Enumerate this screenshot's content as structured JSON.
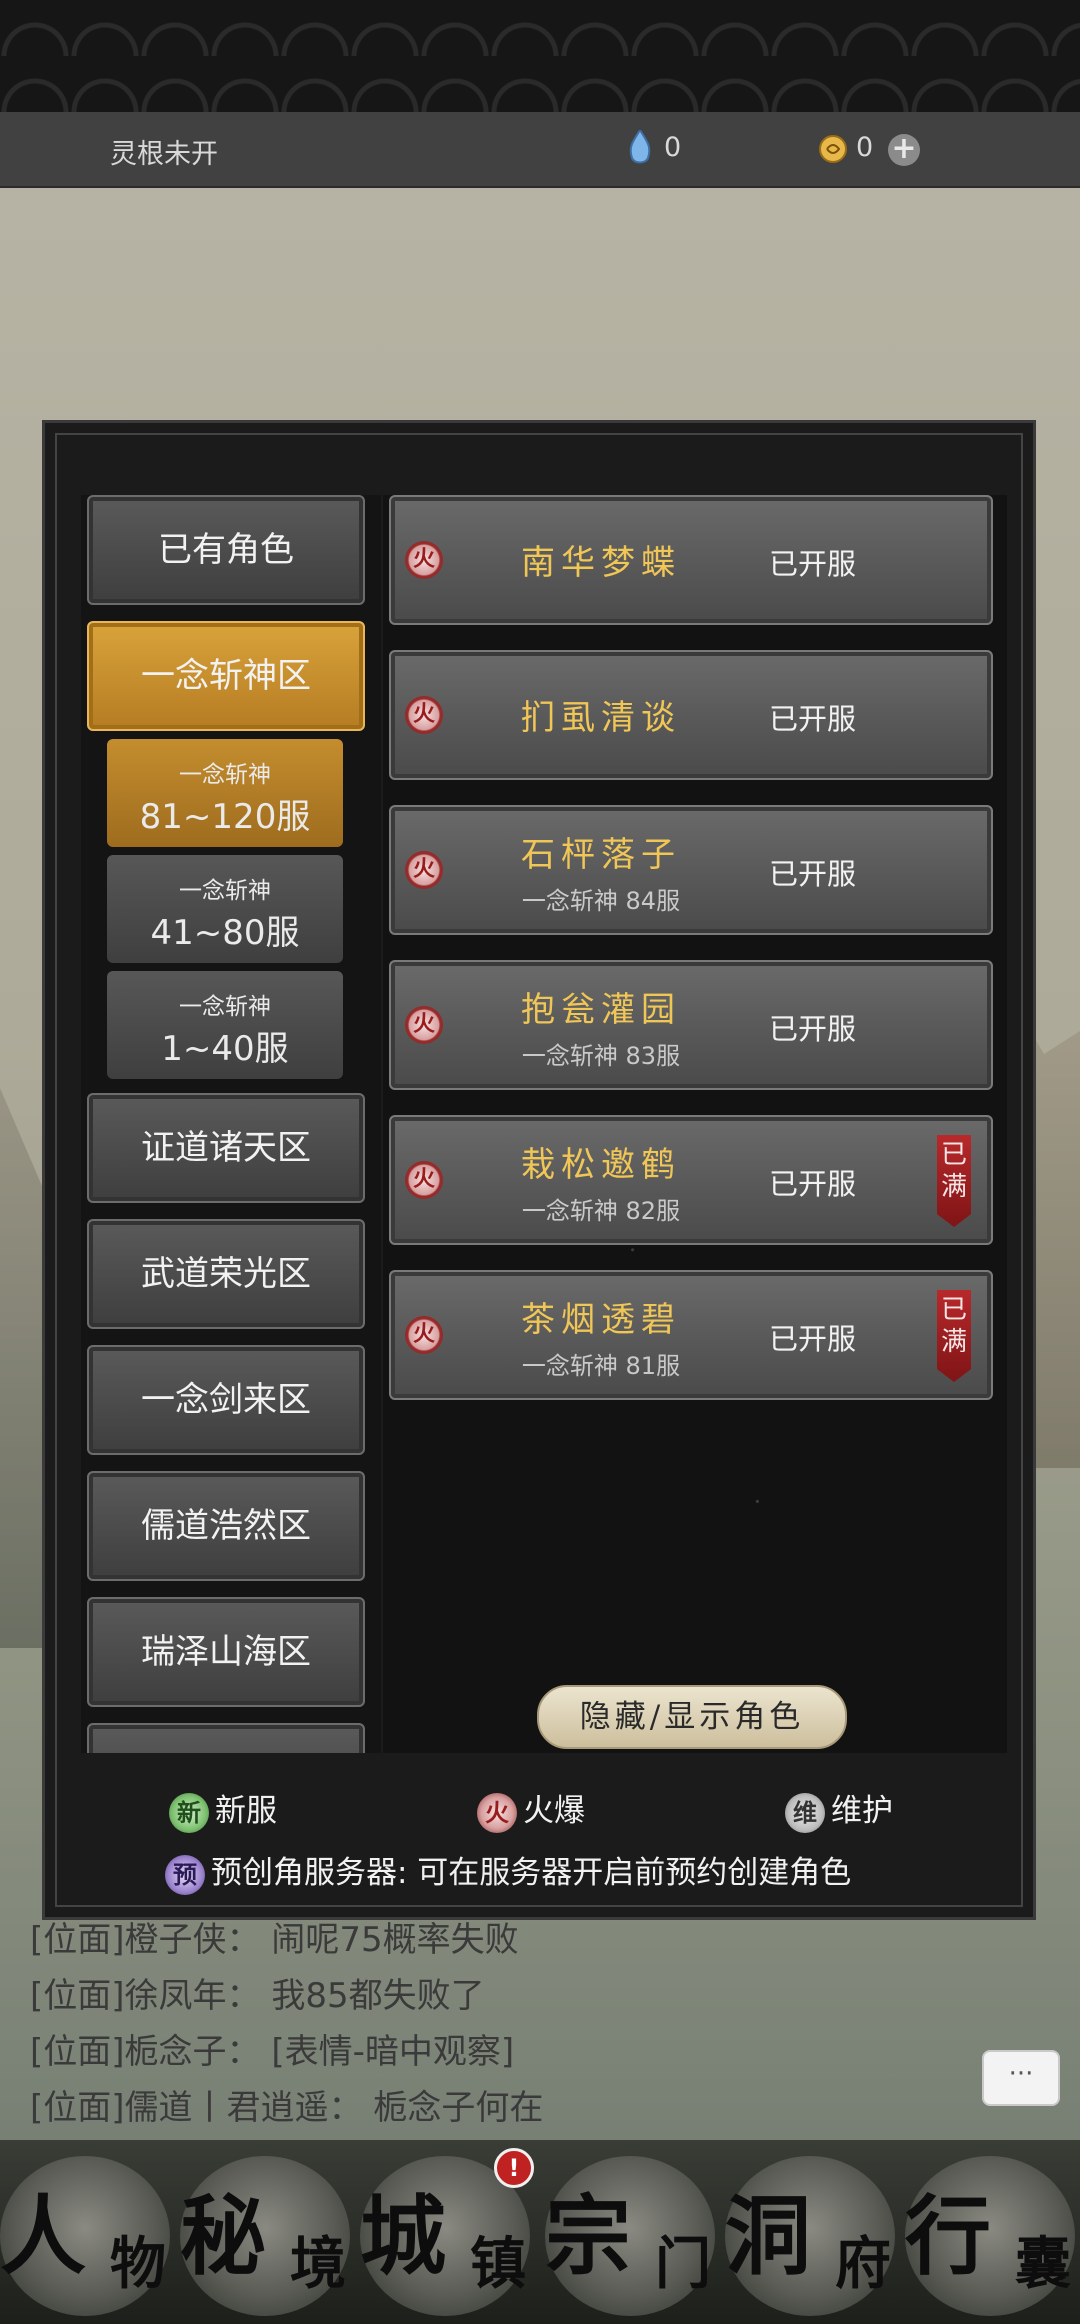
{
  "status": {
    "root_label": "灵根未开",
    "stone_value": "0",
    "coin_value": "0",
    "plus_symbol": "+"
  },
  "zones": [
    {
      "label": "已有角色",
      "active": false
    },
    {
      "label": "一念斩神区",
      "active": true
    },
    {
      "label": "证道诸天区",
      "active": false
    },
    {
      "label": "武道荣光区",
      "active": false
    },
    {
      "label": "一念剑来区",
      "active": false
    },
    {
      "label": "儒道浩然区",
      "active": false
    },
    {
      "label": "瑞泽山海区",
      "active": false
    }
  ],
  "subzones": [
    {
      "line1": "一念斩神",
      "line2": "81~120服",
      "active": true
    },
    {
      "line1": "一念斩神",
      "line2": "41~80服",
      "active": false
    },
    {
      "line1": "一念斩神",
      "line2": "1~40服",
      "active": false
    }
  ],
  "servers": [
    {
      "badge": "火",
      "name": "南华梦蝶",
      "sub": "",
      "status": "已开服",
      "full": ""
    },
    {
      "badge": "火",
      "name": "扪虱清谈",
      "sub": "",
      "status": "已开服",
      "full": ""
    },
    {
      "badge": "火",
      "name": "石枰落子",
      "sub": "一念斩神 84服",
      "status": "已开服",
      "full": ""
    },
    {
      "badge": "火",
      "name": "抱瓮灌园",
      "sub": "一念斩神 83服",
      "status": "已开服",
      "full": ""
    },
    {
      "badge": "火",
      "name": "栽松邀鹤",
      "sub": "一念斩神 82服",
      "status": "已开服",
      "full": "已满"
    },
    {
      "badge": "火",
      "name": "茶烟透碧",
      "sub": "一念斩神 81服",
      "status": "已开服",
      "full": "已满"
    }
  ],
  "toggle_label": "隐藏/显示角色",
  "legend": {
    "new_badge": "新",
    "new_label": "新服",
    "hot_badge": "火",
    "hot_label": "火爆",
    "maint_badge": "维",
    "maint_label": "维护",
    "pre_badge": "预",
    "pre_label": "预创角服务器: 可在服务器开启前预约创建角色"
  },
  "chat": [
    "[位面]橙子侠：  闹呢75概率失败",
    "[位面]徐凤年：  我85都失败了",
    "[位面]栀念子：  [表情-暗中观察]",
    "[位面]儒道丨君逍遥：  栀念子何在"
  ],
  "chat_button": "···",
  "nav": [
    {
      "big": "人",
      "small": "物"
    },
    {
      "big": "秘",
      "small": "境"
    },
    {
      "big": "城",
      "small": "镇"
    },
    {
      "big": "宗",
      "small": "门"
    },
    {
      "big": "洞",
      "small": "府"
    },
    {
      "big": "行",
      "small": "囊"
    }
  ],
  "nav_badge": "!",
  "colors": {
    "accent": "#d9a33b",
    "server_name": "#f0c657",
    "full_tag": "#b8292b"
  }
}
